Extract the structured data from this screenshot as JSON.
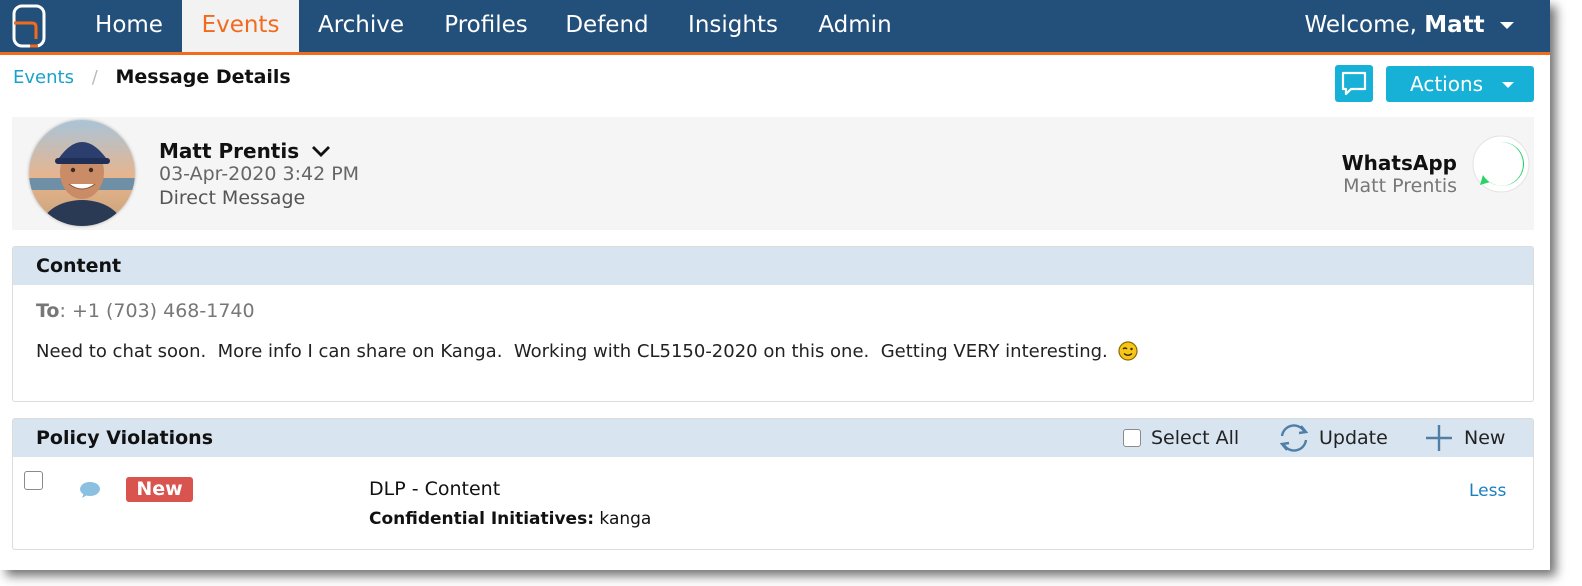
{
  "nav": {
    "items": [
      {
        "label": "Home",
        "active": false
      },
      {
        "label": "Events",
        "active": true
      },
      {
        "label": "Archive",
        "active": false
      },
      {
        "label": "Profiles",
        "active": false
      },
      {
        "label": "Defend",
        "active": false
      },
      {
        "label": "Insights",
        "active": false
      },
      {
        "label": "Admin",
        "active": false
      }
    ],
    "welcome_prefix": "Welcome,",
    "welcome_user": "Matt"
  },
  "breadcrumb": {
    "parent": "Events",
    "separator": "/",
    "current": "Message Details"
  },
  "toolbar": {
    "actions_label": "Actions",
    "chat_icon": "chat-bubble-icon"
  },
  "message_header": {
    "sender_name": "Matt Prentis",
    "timestamp": "03-Apr-2020 3:42 PM",
    "message_type": "Direct Message",
    "channel": "WhatsApp",
    "channel_user": "Matt Prentis",
    "channel_icon": "whatsapp-icon"
  },
  "content": {
    "heading": "Content",
    "to_label": "To",
    "to_value": ": +1 (703) 468-1740",
    "body": "Need to chat soon.  More info I can share on Kanga.  Working with CL5150-2020 on this one.  Getting VERY interesting.",
    "emoji": "wink-emoji"
  },
  "violations": {
    "heading": "Policy Violations",
    "select_all_label": "Select All",
    "update_label": "Update",
    "new_label": "New",
    "rows": [
      {
        "badge": "New",
        "policy": "DLP - Content",
        "detail_label": "Confidential Initiatives:",
        "detail_value": " kanga",
        "toggle_label": "Less"
      }
    ]
  },
  "colors": {
    "nav_bg": "#23507a",
    "accent_orange": "#f26b1d",
    "button_cyan": "#17b1d8",
    "panel_header": "#d8e5f1",
    "badge_red": "#d9534f",
    "link_blue": "#1a7fc1",
    "whatsapp_green": "#25d366"
  }
}
